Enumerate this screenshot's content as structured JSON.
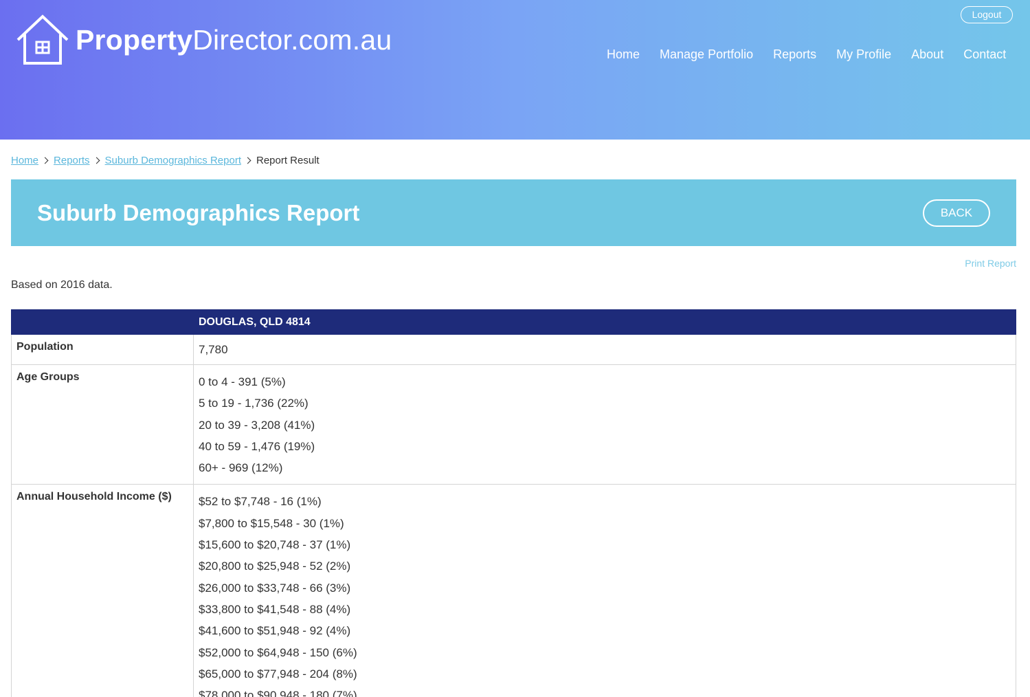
{
  "header": {
    "logo": {
      "part1": "Property",
      "part2": "Director.com.au"
    },
    "logout_label": "Logout",
    "nav": [
      "Home",
      "Manage Portfolio",
      "Reports",
      "My Profile",
      "About",
      "Contact"
    ]
  },
  "breadcrumb": {
    "items": [
      "Home",
      "Reports",
      "Suburb Demographics Report"
    ],
    "current": "Report Result"
  },
  "report": {
    "title": "Suburb Demographics Report",
    "back_label": "BACK",
    "print_label": "Print Report",
    "based_on": "Based on 2016 data.",
    "table": {
      "column_header": "DOUGLAS, QLD 4814",
      "rows": [
        {
          "label": "Population",
          "values": [
            "7,780"
          ]
        },
        {
          "label": "Age Groups",
          "values": [
            "0 to 4 - 391 (5%)",
            "5 to 19 - 1,736 (22%)",
            "20 to 39 - 3,208 (41%)",
            "40 to 59 - 1,476 (19%)",
            "60+ - 969 (12%)"
          ]
        },
        {
          "label": "Annual Household Income ($)",
          "values": [
            "$52 to $7,748 - 16 (1%)",
            "$7,800 to $15,548 - 30 (1%)",
            "$15,600 to $20,748 - 37 (1%)",
            "$20,800 to $25,948 - 52 (2%)",
            "$26,000 to $33,748 - 66 (3%)",
            "$33,800 to $41,548 - 88 (4%)",
            "$41,600 to $51,948 - 92 (4%)",
            "$52,000 to $64,948 - 150 (6%)",
            "$65,000 to $77,948 - 204 (8%)",
            "$78,000 to $90,948 - 180 (7%)"
          ]
        }
      ]
    }
  },
  "colors": {
    "header_gradient_start": "#6b6ff0",
    "header_gradient_end": "#74c6ea",
    "title_bar": "#6fc7e2",
    "table_header": "#1e2b7a",
    "link": "#5bb7dc"
  }
}
